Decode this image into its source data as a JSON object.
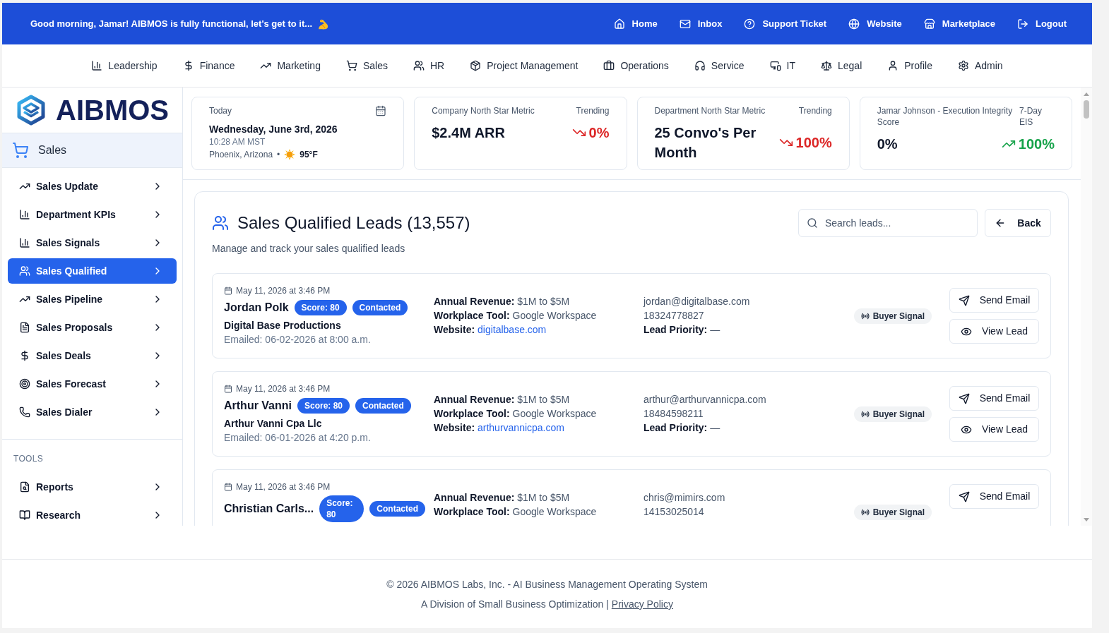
{
  "top_bar": {
    "greeting": "Good morning, Jamar! AIBMOS is fully functional, let's get to it...",
    "links": [
      "Home",
      "Inbox",
      "Support Ticket",
      "Website",
      "Marketplace",
      "Logout"
    ]
  },
  "department_nav": [
    "Leadership",
    "Finance",
    "Marketing",
    "Sales",
    "HR",
    "Project Management",
    "Operations",
    "Service",
    "IT",
    "Legal",
    "Profile",
    "Admin"
  ],
  "sidebar": {
    "logo": "AIBMOS",
    "section": "Sales",
    "items": [
      {
        "label": "Sales Update",
        "selected": false
      },
      {
        "label": "Department KPIs",
        "selected": false
      },
      {
        "label": "Sales Signals",
        "selected": false
      },
      {
        "label": "Sales Qualified",
        "selected": true
      },
      {
        "label": "Sales Pipeline",
        "selected": false
      },
      {
        "label": "Sales Proposals",
        "selected": false
      },
      {
        "label": "Sales Deals",
        "selected": false
      },
      {
        "label": "Sales Forecast",
        "selected": false
      },
      {
        "label": "Sales Dialer",
        "selected": false
      }
    ],
    "tools_heading": "TOOLS",
    "tools": [
      {
        "label": "Reports",
        "selected": false
      },
      {
        "label": "Research",
        "selected": false
      }
    ]
  },
  "today_card": {
    "label": "Today",
    "date": "Wednesday, June 3rd, 2026",
    "time": "10:28 AM MST",
    "location": "Phoenix, Arizona",
    "separator": "•",
    "temperature": "95°F"
  },
  "metric_cards": [
    {
      "label": "Company North Star Metric",
      "trend_label": "Trending",
      "value": "$2.4M ARR",
      "trend_value": "0%",
      "kind": "falling"
    },
    {
      "label": "Department North Star Metric",
      "trend_label": "Trending",
      "value": "25 Convo's Per Month",
      "trend_value": "100%",
      "kind": "falling"
    },
    {
      "label": "Jamar Johnson - Execution Integrity Score",
      "trend_label": "7-Day EIS",
      "value": "0%",
      "trend_value": "100%",
      "kind": "rising"
    }
  ],
  "leads_panel": {
    "title": "Sales Qualified Leads (13,557)",
    "subtitle": "Manage and track your sales qualified leads",
    "search": {
      "placeholder": "Search leads..."
    },
    "back_button": "Back",
    "leads": [
      {
        "date": "May 11, 2026 at 3:46 PM",
        "name": "Jordan Polk",
        "score": "Score: 80",
        "status": "Contacted",
        "company": "Digital Base Productions",
        "emailed": "Emailed: 06-02-2026 at 8:00 a.m.",
        "details": [
          {
            "kind": "text",
            "label": "Annual Revenue:",
            "value": "$1M to $5M"
          },
          {
            "kind": "text",
            "label": "Workplace Tool:",
            "value": "Google Workspace"
          },
          {
            "kind": "link",
            "label": "Website:",
            "value": "digitalbase.com"
          }
        ],
        "contact": [
          {
            "kind": "email",
            "value": "jordan@digitalbase.com"
          },
          {
            "kind": "phone",
            "value": "18324778827"
          },
          {
            "kind": "field",
            "label": "Lead Priority:",
            "value": "—"
          }
        ],
        "signal": "Buyer Signal",
        "actions": [
          "Send Email",
          "View Lead"
        ]
      },
      {
        "date": "May 11, 2026 at 3:46 PM",
        "name": "Arthur Vanni",
        "score": "Score: 80",
        "status": "Contacted",
        "company": "Arthur Vanni Cpa Llc",
        "emailed": "Emailed: 06-01-2026 at 4:20 p.m.",
        "details": [
          {
            "kind": "text",
            "label": "Annual Revenue:",
            "value": "$1M to $5M"
          },
          {
            "kind": "text",
            "label": "Workplace Tool:",
            "value": "Google Workspace"
          },
          {
            "kind": "link",
            "label": "Website:",
            "value": "arthurvannicpa.com"
          }
        ],
        "contact": [
          {
            "kind": "email",
            "value": "arthur@arthurvannicpa.com"
          },
          {
            "kind": "phone",
            "value": "18484598211"
          },
          {
            "kind": "field",
            "label": "Lead Priority:",
            "value": "—"
          }
        ],
        "signal": "Buyer Signal",
        "actions": [
          "Send Email",
          "View Lead"
        ]
      },
      {
        "date": "May 11, 2026 at 3:46 PM",
        "name": "Christian Carls...",
        "score": "Score: 80",
        "status": "Contacted",
        "details": [
          {
            "kind": "text",
            "label": "Annual Revenue:",
            "value": "$1M to $5M"
          },
          {
            "kind": "text",
            "label": "Workplace Tool:",
            "value": "Google Workspace"
          }
        ],
        "contact": [
          {
            "kind": "email",
            "value": "chris@mimirs.com"
          },
          {
            "kind": "phone",
            "value": "14153025014"
          }
        ],
        "signal": "Buyer Signal",
        "actions": [
          "Send Email"
        ]
      }
    ]
  },
  "footer": {
    "copyright": "© 2026 AIBMOS Labs, Inc. - AI Business Management Operating System",
    "division": "A Division of Small Business Optimization |",
    "privacy_link": "Privacy Policy"
  }
}
